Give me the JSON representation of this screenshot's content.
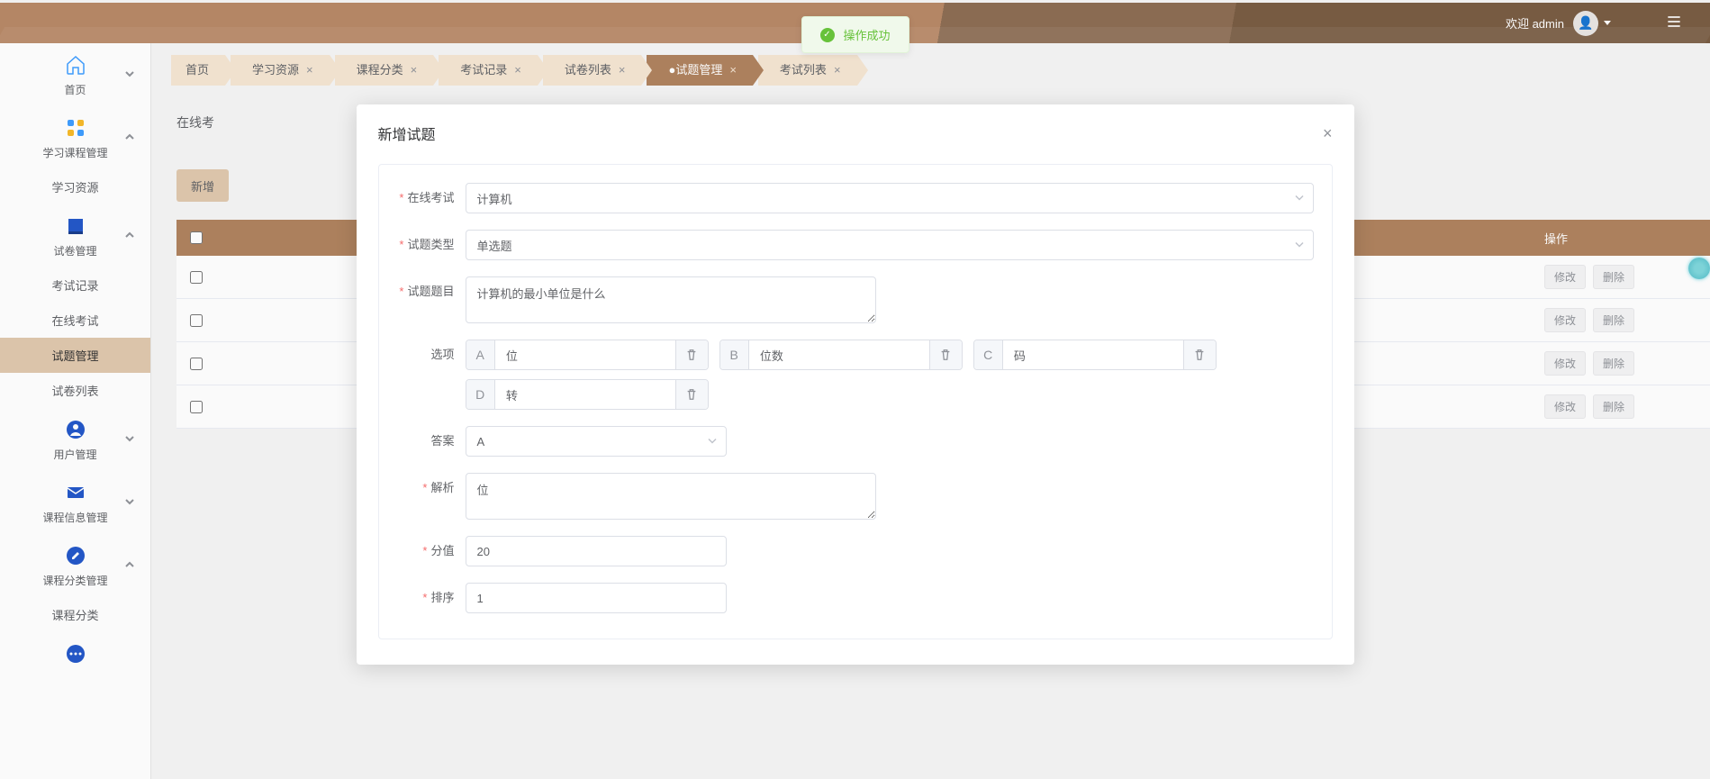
{
  "header": {
    "welcome_prefix": "欢迎",
    "username": "admin"
  },
  "sidebar": {
    "items": [
      {
        "label": "首页"
      },
      {
        "label": "学习课程管理"
      },
      {
        "label": "学习资源"
      },
      {
        "label": "试卷管理"
      },
      {
        "label": "考试记录"
      },
      {
        "label": "在线考试"
      },
      {
        "label": "试题管理"
      },
      {
        "label": "试卷列表"
      },
      {
        "label": "用户管理"
      },
      {
        "label": "课程信息管理"
      },
      {
        "label": "课程分类管理"
      },
      {
        "label": "课程分类"
      }
    ]
  },
  "breadcrumbs": [
    {
      "label": "首页",
      "closable": false
    },
    {
      "label": "学习资源",
      "closable": true
    },
    {
      "label": "课程分类",
      "closable": true
    },
    {
      "label": "考试记录",
      "closable": true
    },
    {
      "label": "试卷列表",
      "closable": true
    },
    {
      "label": "试题管理",
      "closable": true,
      "active": true,
      "dot": true
    },
    {
      "label": "考试列表",
      "closable": true
    }
  ],
  "page_section_prefix": "在线考",
  "toolbar": {
    "add_label": "新增"
  },
  "table": {
    "ops_header": "操作",
    "edit_label": "修改",
    "delete_label": "删除",
    "row_count": 4
  },
  "dialog": {
    "title": "新增试题",
    "fields": {
      "exam": {
        "label": "在线考试",
        "value": "计算机"
      },
      "type": {
        "label": "试题类型",
        "value": "单选题"
      },
      "title": {
        "label": "试题题目",
        "value": "计算机的最小单位是什么"
      },
      "options_label": "选项",
      "options": [
        {
          "letter": "A",
          "text": "位"
        },
        {
          "letter": "B",
          "text": "位数"
        },
        {
          "letter": "C",
          "text": "码"
        },
        {
          "letter": "D",
          "text": "转"
        }
      ],
      "answer": {
        "label": "答案",
        "value": "A"
      },
      "analysis": {
        "label": "解析",
        "value": "位"
      },
      "score": {
        "label": "分值",
        "value": "20"
      },
      "sort": {
        "label": "排序",
        "value": "1"
      }
    }
  },
  "toast": {
    "message": "操作成功"
  }
}
